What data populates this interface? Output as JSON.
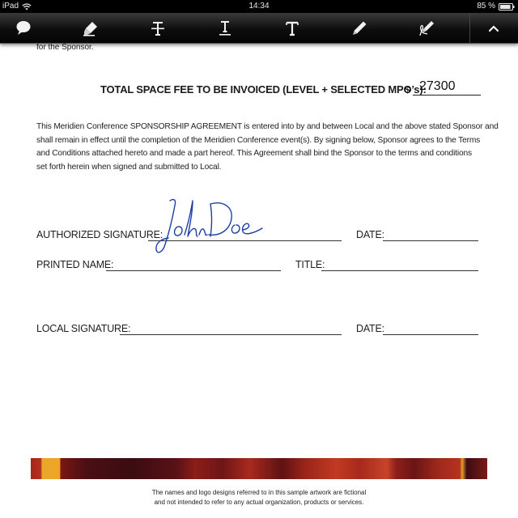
{
  "status_bar": {
    "device": "iPad",
    "time": "14:34",
    "battery": "85 %"
  },
  "toolbar": {
    "tools": [
      {
        "name": "comment-tool",
        "icon": "speech-bubble-icon"
      },
      {
        "name": "highlight-tool",
        "icon": "highlighter-icon"
      },
      {
        "name": "strikethrough-tool",
        "icon": "strikethrough-t-icon"
      },
      {
        "name": "underline-tool",
        "icon": "underline-t-icon"
      },
      {
        "name": "text-tool",
        "icon": "text-t-icon"
      },
      {
        "name": "pen-tool",
        "icon": "pen-icon"
      },
      {
        "name": "signature-tool",
        "icon": "fountain-pen-signature-icon"
      },
      {
        "name": "collapse-toolbar",
        "icon": "chevron-up-icon"
      }
    ]
  },
  "document": {
    "intro_tail": "for the Sponsor.",
    "fee": {
      "label": "TOTAL SPACE FEE TO BE INVOICED (LEVEL + SELECTED MPO’s):",
      "currency": "$",
      "value": "27300"
    },
    "agreement_lines": [
      "This Meridien Conference SPONSORSHIP AGREEMENT is entered into by and between Local and the above stated Sponsor and",
      "shall remain in effect until the completion of the Meridien Conference event(s). By signing below, Sponsor agrees to the Terms",
      "and Conditions attached hereto and made a part hereof. This Agreement shall bind the Sponsor to the terms and conditions",
      "set forth herein when signed and submitted to Local."
    ],
    "fields": {
      "authorized_signature": "AUTHORIZED SIGNATURE:",
      "date_1": "DATE:",
      "printed_name": "PRINTED NAME:",
      "title": "TITLE:",
      "local_signature": "LOCAL SIGNATURE:",
      "date_2": "DATE:"
    },
    "signature_text": "John Doe",
    "footer_lines": [
      "The names and logo designs referred to in this sample artwork are fictional",
      "and not intended to refer to any actual organization, products or services."
    ]
  },
  "colors": {
    "signature_ink": "#1d3fa6",
    "toolbar_bg": "#111111",
    "banner_red": "#a8291d",
    "banner_gold": "#f0a628"
  }
}
